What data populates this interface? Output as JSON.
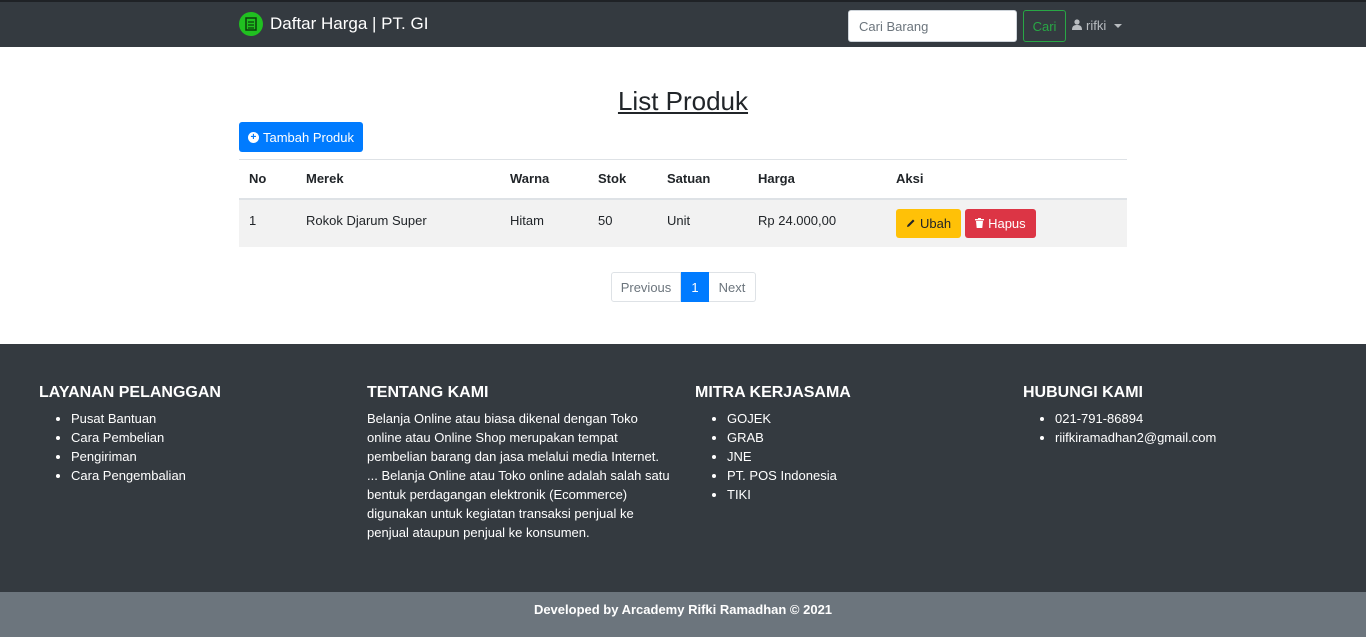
{
  "navbar": {
    "brand": "Daftar Harga | PT. GI",
    "search_placeholder": "Cari Barang",
    "search_button": "Cari",
    "user": "rifki"
  },
  "main": {
    "title": "List Produk",
    "add_button": "Tambah Produk",
    "table": {
      "headers": [
        "No",
        "Merek",
        "Warna",
        "Stok",
        "Satuan",
        "Harga",
        "Aksi"
      ],
      "rows": [
        {
          "no": "1",
          "merek": "Rokok Djarum Super",
          "warna": "Hitam",
          "stok": "50",
          "satuan": "Unit",
          "harga": "Rp 24.000,00",
          "edit": "Ubah",
          "delete": "Hapus"
        }
      ]
    },
    "pagination": {
      "previous": "Previous",
      "current": "1",
      "next": "Next"
    }
  },
  "footer": {
    "layanan": {
      "title": "LAYANAN PELANGGAN",
      "items": [
        "Pusat Bantuan",
        "Cara Pembelian",
        "Pengiriman",
        "Cara Pengembalian"
      ]
    },
    "tentang": {
      "title": "TENTANG KAMI",
      "text": "Belanja Online atau biasa dikenal dengan Toko online atau Online Shop merupakan tempat pembelian barang dan jasa melalui media Internet. ... Belanja Online atau Toko online adalah salah satu bentuk perdagangan elektronik (Ecommerce) digunakan untuk kegiatan transaksi penjual ke penjual ataupun penjual ke konsumen."
    },
    "mitra": {
      "title": "MITRA KERJASAMA",
      "items": [
        "GOJEK",
        "GRAB",
        "JNE",
        "PT. POS Indonesia",
        "TIKI"
      ]
    },
    "hubungi": {
      "title": "HUBUNGI KAMI",
      "items": [
        "021-791-86894",
        "riifkiramadhan2@gmail.com"
      ]
    },
    "copyright": "Developed by Arcademy Rifki Ramadhan © 2021"
  },
  "colors": {
    "navbar": "#343a40",
    "primary": "#007bff",
    "success": "#28a745",
    "warning": "#ffc107",
    "danger": "#dc3545",
    "brand_logo": "#20c020"
  }
}
